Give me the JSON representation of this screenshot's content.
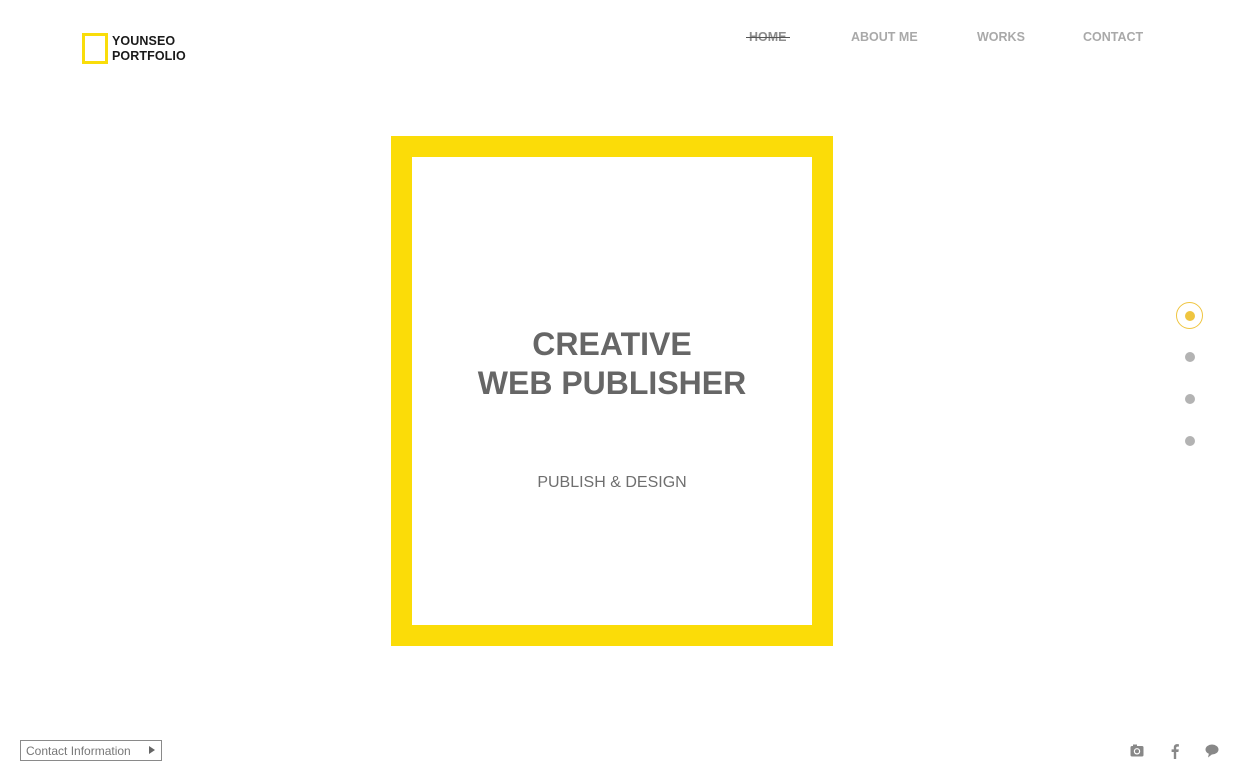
{
  "logo": {
    "line1": "YOUNSEO",
    "line2": "PORTFOLIO"
  },
  "nav": {
    "items": [
      {
        "label": "HOME",
        "active": true
      },
      {
        "label": "ABOUT ME"
      },
      {
        "label": "WORKS"
      },
      {
        "label": "CONTACT"
      }
    ]
  },
  "hero": {
    "headline_line1": "CREATIVE",
    "headline_line2": "WEB PUBLISHER",
    "subline": "PUBLISH & DESIGN"
  },
  "page_dots": {
    "count": 4,
    "active_index": 0
  },
  "footer": {
    "contact_label": "Contact Information",
    "social_icons": [
      "camera-icon",
      "facebook-icon",
      "speech-bubble-icon"
    ]
  },
  "colors": {
    "accent_yellow": "#fbdc08",
    "dot_active": "#efc540",
    "dot_inactive": "#b3b3b3",
    "text_gray": "#666666"
  }
}
